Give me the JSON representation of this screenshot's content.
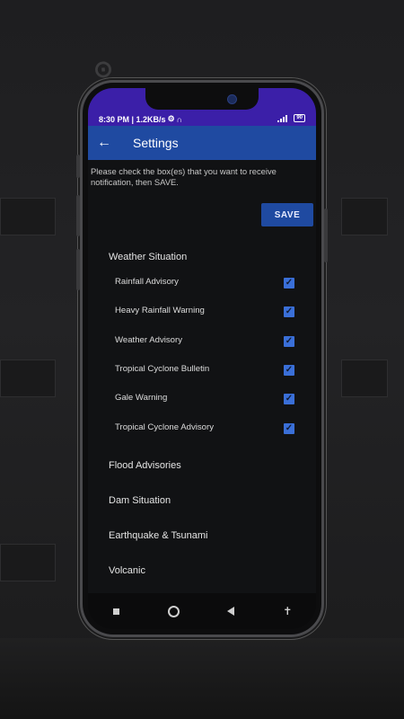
{
  "status_bar": {
    "time_info": "8:30 PM | 1.2KB/s",
    "battery": "90"
  },
  "app_bar": {
    "back_icon": "arrow-left-icon",
    "title": "Settings"
  },
  "instructions": "Please check the box(es) that you want to receive notification, then SAVE.",
  "save_label": "SAVE",
  "sections": [
    {
      "title": "Weather Situation",
      "items": [
        {
          "label": "Rainfall Advisory",
          "checked": true
        },
        {
          "label": "Heavy Rainfall Warning",
          "checked": true
        },
        {
          "label": "Weather Advisory",
          "checked": true
        },
        {
          "label": "Tropical Cyclone Bulletin",
          "checked": true
        },
        {
          "label": "Gale Warning",
          "checked": true
        },
        {
          "label": "Tropical Cyclone Advisory",
          "checked": true
        }
      ]
    },
    {
      "title": "Flood Advisories"
    },
    {
      "title": "Dam Situation"
    },
    {
      "title": "Earthquake & Tsunami"
    },
    {
      "title": "Volcanic"
    }
  ],
  "nav_bar": [
    "recent-apps-icon",
    "home-icon",
    "back-icon",
    "accessibility-icon"
  ],
  "colors": {
    "status_bar": "#3b1fa8",
    "app_bar": "#1f4aa1",
    "checkbox": "#3a6fd8",
    "background": "#111214"
  }
}
